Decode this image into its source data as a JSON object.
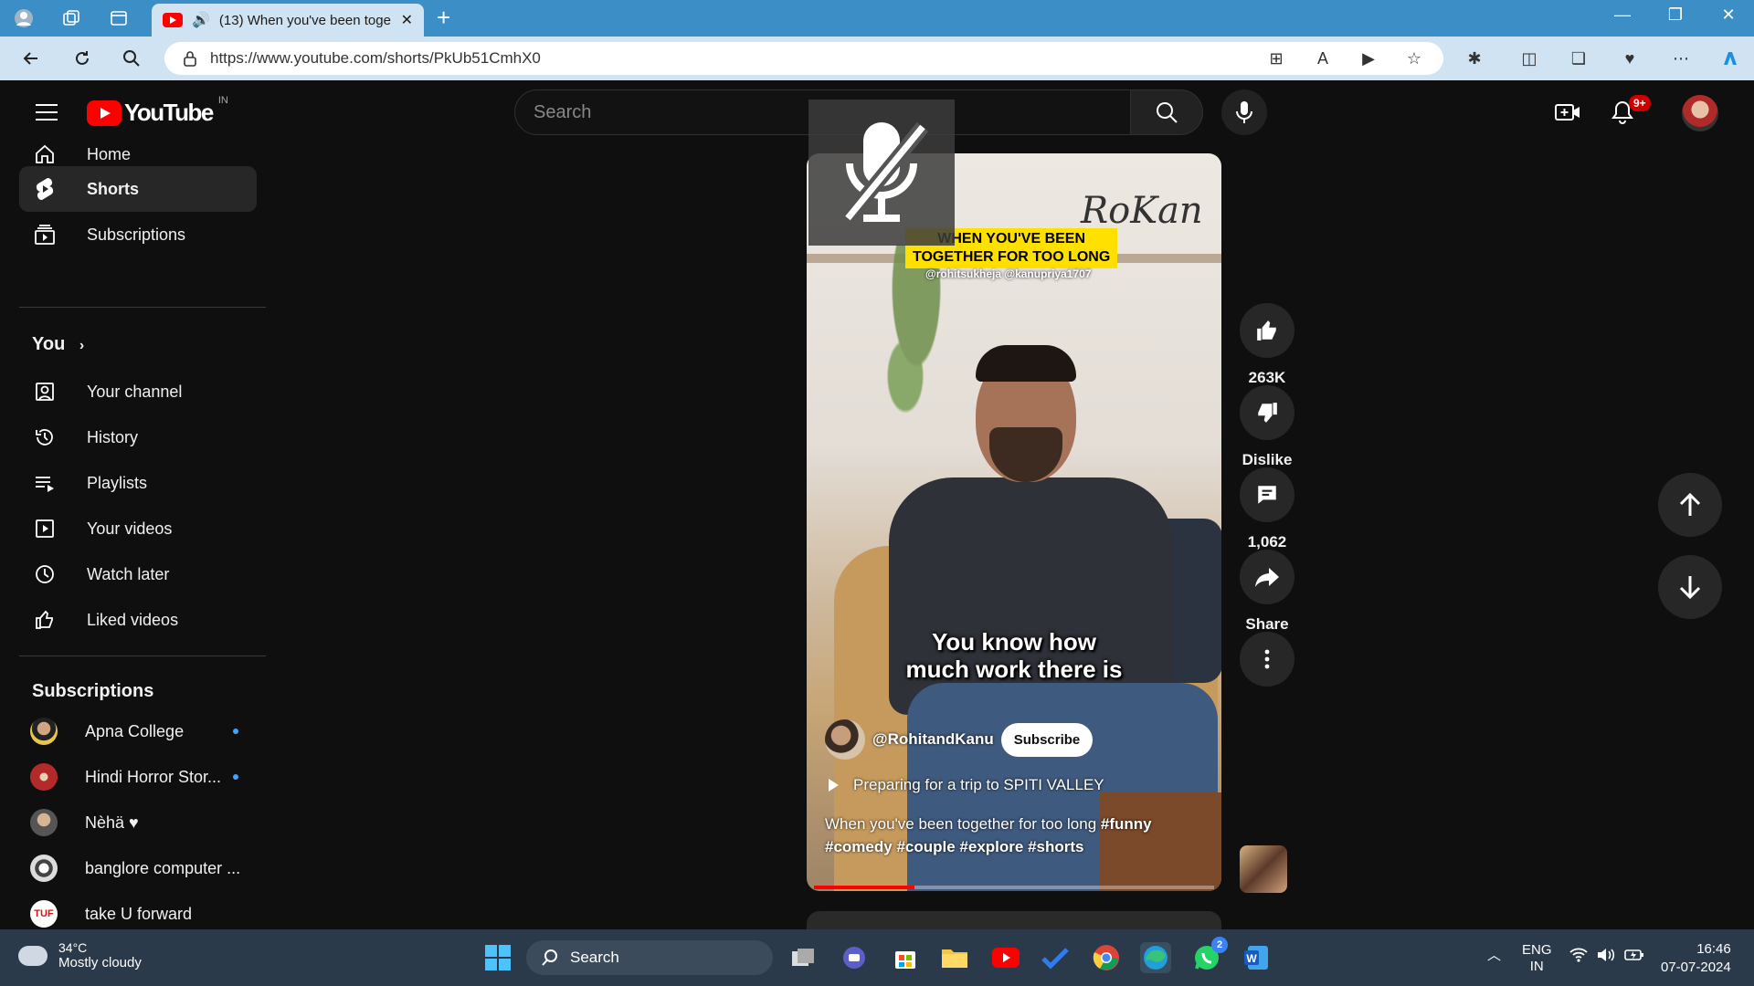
{
  "browser": {
    "tab_title": "(13) When you've been toge",
    "url": "https://www.youtube.com/shorts/PkUb51CmhX0"
  },
  "header": {
    "logo_text": "YouTube",
    "country_code": "IN",
    "search_placeholder": "Search",
    "notification_count": "9+"
  },
  "sidebar": {
    "main": [
      {
        "label": "Home",
        "icon": "home-icon"
      },
      {
        "label": "Shorts",
        "icon": "shorts-icon",
        "active": true
      },
      {
        "label": "Subscriptions",
        "icon": "subscriptions-icon"
      }
    ],
    "you_heading": "You",
    "you_items": [
      {
        "label": "Your channel",
        "icon": "channel-icon"
      },
      {
        "label": "History",
        "icon": "history-icon"
      },
      {
        "label": "Playlists",
        "icon": "playlists-icon"
      },
      {
        "label": "Your videos",
        "icon": "videos-icon"
      },
      {
        "label": "Watch later",
        "icon": "clock-icon"
      },
      {
        "label": "Liked videos",
        "icon": "thumbs-up-icon"
      }
    ],
    "subs_heading": "Subscriptions",
    "subscriptions": [
      {
        "label": "Apna College",
        "new": true
      },
      {
        "label": "Hindi Horror Stor...",
        "new": true
      },
      {
        "label": "Nèhä ♥",
        "new": false
      },
      {
        "label": "banglore computer ...",
        "new": false
      },
      {
        "label": "take U forward",
        "new": false
      }
    ]
  },
  "short": {
    "caption_line1": "WHEN YOU'VE BEEN",
    "caption_line2": "TOGETHER FOR TOO LONG",
    "caption_handles": "@rohitsukheja @kanupriya1707",
    "signature": "RoKan",
    "subtitle_line1": "You know how",
    "subtitle_line2": "much work there is",
    "channel": "@RohitandKanu",
    "subscribe_label": "Subscribe",
    "playlist": "Preparing for a trip to SPITI VALLEY",
    "description_text": "When you've been together for too long",
    "tags": [
      "#funny",
      "#comedy",
      "#couple",
      "#explore",
      "#shorts"
    ],
    "progress": 0.25
  },
  "actions": {
    "likes": "263K",
    "dislike_label": "Dislike",
    "comments": "1,062",
    "share_label": "Share"
  },
  "taskbar": {
    "temperature": "34°C",
    "weather": "Mostly cloudy",
    "search_label": "Search",
    "lang1": "ENG",
    "lang2": "IN",
    "time": "16:46",
    "date": "07-07-2024",
    "whatsapp_badge": "2"
  },
  "colors": {
    "accent": "#ff0000",
    "background": "#0f0f0f",
    "caption_yellow": "#ffe000",
    "live_dot": "#3ea6ff"
  }
}
